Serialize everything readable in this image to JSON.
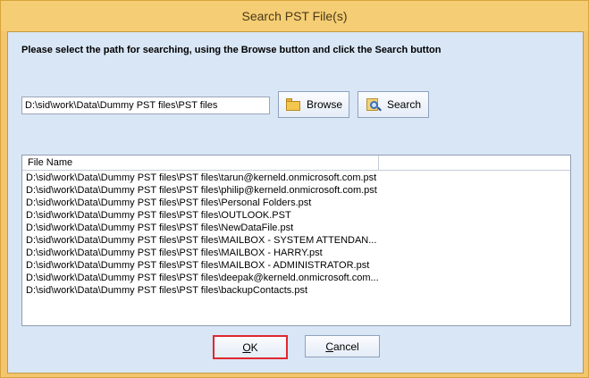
{
  "window": {
    "title": "Search PST File(s)"
  },
  "instruction": "Please select the path for searching, using the Browse button and click the Search button",
  "path": {
    "value": "D:\\sid\\work\\Data\\Dummy PST files\\PST files"
  },
  "buttons": {
    "browse": {
      "label": "Browse",
      "icon": "folder-icon"
    },
    "search": {
      "label": "Search",
      "icon": "magnifier-icon"
    },
    "ok": {
      "label": "OK"
    },
    "cancel": {
      "label": "Cancel"
    }
  },
  "file_list": {
    "columns": [
      "File Name"
    ],
    "rows": [
      "D:\\sid\\work\\Data\\Dummy PST files\\PST files\\tarun@kerneld.onmicrosoft.com.pst",
      "D:\\sid\\work\\Data\\Dummy PST files\\PST files\\philip@kerneld.onmicrosoft.com.pst",
      "D:\\sid\\work\\Data\\Dummy PST files\\PST files\\Personal Folders.pst",
      "D:\\sid\\work\\Data\\Dummy PST files\\PST files\\OUTLOOK.PST",
      "D:\\sid\\work\\Data\\Dummy PST files\\PST files\\NewDataFile.pst",
      "D:\\sid\\work\\Data\\Dummy PST files\\PST files\\MAILBOX - SYSTEM ATTENDAN...",
      "D:\\sid\\work\\Data\\Dummy PST files\\PST files\\MAILBOX - HARRY.pst",
      "D:\\sid\\work\\Data\\Dummy PST files\\PST files\\MAILBOX - ADMINISTRATOR.pst",
      "D:\\sid\\work\\Data\\Dummy PST files\\PST files\\deepak@kerneld.onmicrosoft.com...",
      "D:\\sid\\work\\Data\\Dummy PST files\\PST files\\backupContacts.pst"
    ]
  },
  "colors": {
    "frame": "#f2c56e",
    "client": "#d9e6f6",
    "ok_highlight": "#e0282e"
  }
}
